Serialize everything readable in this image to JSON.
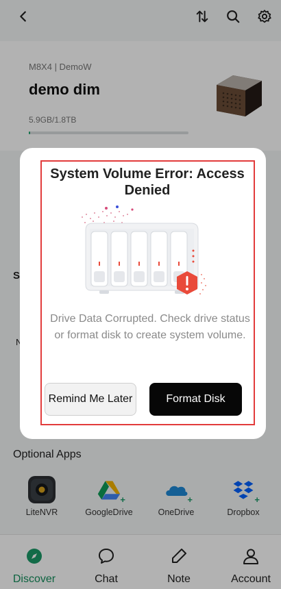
{
  "device": {
    "model_line": "M8X4 | DemoW",
    "name": "demo dim",
    "usage": "5.9GB/1.8TB",
    "usage_fraction": 0.01
  },
  "background_hints": {
    "left_letter_1": "S",
    "left_letter_2": "N"
  },
  "dialog": {
    "title": "System Volume Error: Access Denied",
    "message": "Drive Data Corrupted. Check drive status or format disk to create system volume.",
    "secondary_button": "Remind Me Later",
    "primary_button": "Format Disk",
    "highlight_color": "#e23b3b",
    "warning_color": "#e94a3a"
  },
  "optional_apps": {
    "title": "Optional Apps",
    "items": [
      {
        "label": "LiteNVR",
        "icon": "camera-icon"
      },
      {
        "label": "GoogleDrive",
        "icon": "google-drive-icon"
      },
      {
        "label": "OneDrive",
        "icon": "onedrive-icon"
      },
      {
        "label": "Dropbox",
        "icon": "dropbox-icon"
      }
    ]
  },
  "nav": {
    "items": [
      {
        "label": "Discover",
        "icon": "compass-icon",
        "active": true
      },
      {
        "label": "Chat",
        "icon": "chat-bubble-icon",
        "active": false
      },
      {
        "label": "Note",
        "icon": "pen-icon",
        "active": false
      },
      {
        "label": "Account",
        "icon": "user-icon",
        "active": false
      }
    ],
    "active_color": "#138e5c"
  }
}
